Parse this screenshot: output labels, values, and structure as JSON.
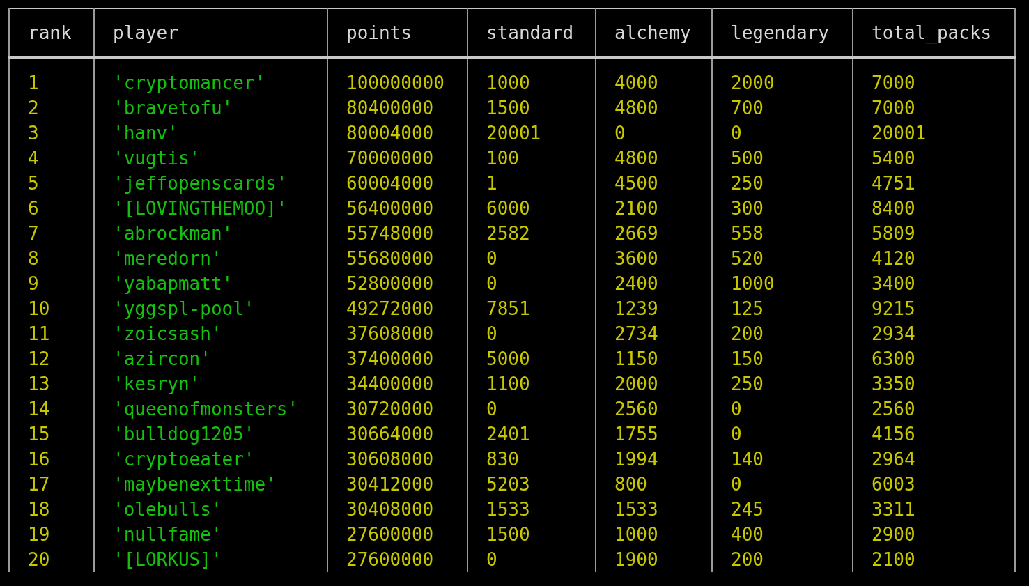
{
  "table": {
    "columns": [
      {
        "label": "rank",
        "kind": "number"
      },
      {
        "label": "player",
        "kind": "string"
      },
      {
        "label": "points",
        "kind": "number"
      },
      {
        "label": "standard",
        "kind": "number"
      },
      {
        "label": "alchemy",
        "kind": "number"
      },
      {
        "label": "legendary",
        "kind": "number"
      },
      {
        "label": "total_packs",
        "kind": "number"
      }
    ],
    "rows": [
      [
        "1",
        "'cryptomancer'",
        "100000000",
        "1000",
        "4000",
        "2000",
        "7000"
      ],
      [
        "2",
        "'bravetofu'",
        "80400000",
        "1500",
        "4800",
        "700",
        "7000"
      ],
      [
        "3",
        "'hanv'",
        "80004000",
        "20001",
        "0",
        "0",
        "20001"
      ],
      [
        "4",
        "'vugtis'",
        "70000000",
        "100",
        "4800",
        "500",
        "5400"
      ],
      [
        "5",
        "'jeffopenscards'",
        "60004000",
        "1",
        "4500",
        "250",
        "4751"
      ],
      [
        "6",
        "'[LOVINGTHEMOO]'",
        "56400000",
        "6000",
        "2100",
        "300",
        "8400"
      ],
      [
        "7",
        "'abrockman'",
        "55748000",
        "2582",
        "2669",
        "558",
        "5809"
      ],
      [
        "8",
        "'meredorn'",
        "55680000",
        "0",
        "3600",
        "520",
        "4120"
      ],
      [
        "9",
        "'yabapmatt'",
        "52800000",
        "0",
        "2400",
        "1000",
        "3400"
      ],
      [
        "10",
        "'yggspl-pool'",
        "49272000",
        "7851",
        "1239",
        "125",
        "9215"
      ],
      [
        "11",
        "'zoicsash'",
        "37608000",
        "0",
        "2734",
        "200",
        "2934"
      ],
      [
        "12",
        "'azircon'",
        "37400000",
        "5000",
        "1150",
        "150",
        "6300"
      ],
      [
        "13",
        "'kesryn'",
        "34400000",
        "1100",
        "2000",
        "250",
        "3350"
      ],
      [
        "14",
        "'queenofmonsters'",
        "30720000",
        "0",
        "2560",
        "0",
        "2560"
      ],
      [
        "15",
        "'bulldog1205'",
        "30664000",
        "2401",
        "1755",
        "0",
        "4156"
      ],
      [
        "16",
        "'cryptoeater'",
        "30608000",
        "830",
        "1994",
        "140",
        "2964"
      ],
      [
        "17",
        "'maybenexttime'",
        "30412000",
        "5203",
        "800",
        "0",
        "6003"
      ],
      [
        "18",
        "'olebulls'",
        "30408000",
        "1533",
        "1533",
        "245",
        "3311"
      ],
      [
        "19",
        "'nullfame'",
        "27600000",
        "1500",
        "1000",
        "400",
        "2900"
      ],
      [
        "20",
        "'[LORKUS]'",
        "27600000",
        "0",
        "1900",
        "200",
        "2100"
      ]
    ]
  }
}
